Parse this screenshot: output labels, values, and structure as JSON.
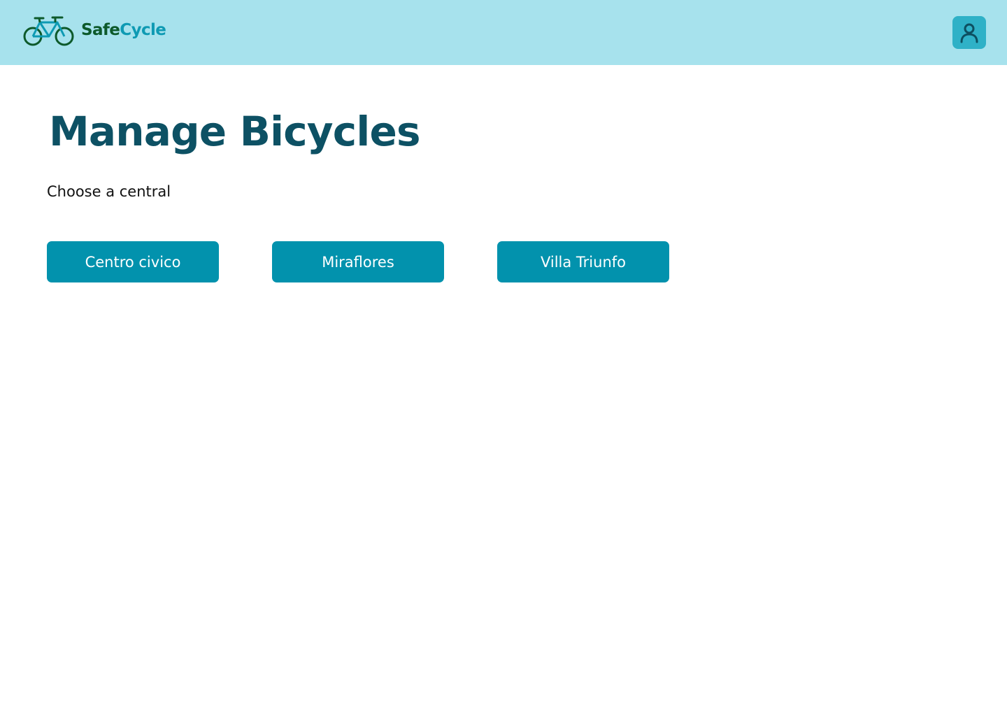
{
  "header": {
    "logo": {
      "icon": "bicycle-icon",
      "text_part1": "Safe",
      "text_part2": "Cycle"
    },
    "profile_icon": "user-icon"
  },
  "main": {
    "title": "Manage Bicycles",
    "subtitle": "Choose a central",
    "centrals": [
      {
        "label": "Centro civico"
      },
      {
        "label": "Miraflores"
      },
      {
        "label": "Villa Triunfo"
      }
    ]
  },
  "colors": {
    "header_bg": "#a7e2ed",
    "title": "#0d5164",
    "button_bg": "#0292ad",
    "button_text": "#ffffff",
    "logo_dark": "#0d5a2b",
    "logo_accent": "#0e9ab3",
    "profile_bg": "#2fb1c7"
  }
}
